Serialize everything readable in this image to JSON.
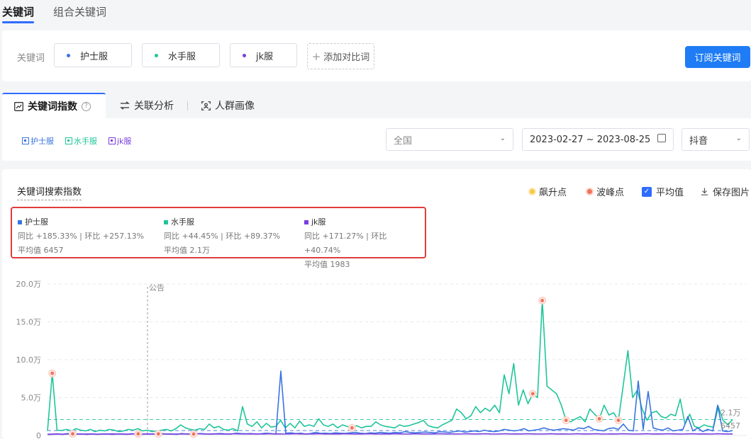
{
  "top_tabs": {
    "active": "关键词",
    "inactive": "组合关键词"
  },
  "keyword_bar": {
    "label": "关键词",
    "keywords": [
      {
        "name": "护士服",
        "color": "#3a74e0"
      },
      {
        "name": "水手服",
        "color": "#1fc59a"
      },
      {
        "name": "jk服",
        "color": "#7a3ee0"
      }
    ],
    "add_label": "添加对比词",
    "subscribe_label": "订阅关键词"
  },
  "analysis_tabs": [
    "关键词指数",
    "关联分析",
    "人群画像"
  ],
  "filters": {
    "region": "全国",
    "date_range": "2023-02-27 ~ 2023-08-25",
    "platform": "抖音"
  },
  "chart_panel": {
    "title": "关键词搜索指数",
    "options": {
      "surge": "飙升点",
      "peak": "波峰点",
      "average": "平均值",
      "average_checked": true,
      "save": "保存图片"
    },
    "summary": [
      {
        "name": "护士服",
        "yoy": "同比 +185.33%",
        "mom": "环比 +257.13%",
        "avg": "平均值 6457",
        "color": "#3a74e0"
      },
      {
        "name": "水手服",
        "yoy": "同比 +44.45%",
        "mom": "环比 +89.37%",
        "avg": "平均值 2.1万",
        "color": "#1fc59a"
      },
      {
        "name": "jk服",
        "yoy": "同比 +171.27%",
        "mom": "环比 +40.74%",
        "avg": "平均值 1983",
        "color": "#7a3ee0"
      }
    ],
    "separator": "|"
  },
  "chart_data": {
    "type": "line",
    "ylim": [
      0,
      200000
    ],
    "yticks": [
      "0",
      "5.0万",
      "10.0万",
      "15.0万",
      "20.0万"
    ],
    "annotation": "公告",
    "end_labels": [
      "2.1万",
      "6457"
    ],
    "series": [
      {
        "name": "水手服",
        "color": "#1fc59a",
        "average": 21000,
        "values": [
          6000,
          82000,
          7000,
          6500,
          8000,
          6000,
          9000,
          7000,
          6000,
          8000,
          5000,
          7000,
          6000,
          8000,
          7000,
          5000,
          6000,
          8000,
          7000,
          9000,
          6000,
          7000,
          5000,
          6000,
          7000,
          8000,
          6000,
          9000,
          14000,
          10000,
          8000,
          7000,
          9000,
          8000,
          15000,
          10000,
          12000,
          8000,
          7000,
          9000,
          6000,
          38000,
          15000,
          12000,
          18000,
          10000,
          16000,
          11000,
          12000,
          20000,
          10000,
          16000,
          10000,
          19000,
          12000,
          14000,
          12000,
          22000,
          14000,
          12000,
          15000,
          10000,
          14000,
          12000,
          10000,
          13000,
          10000,
          12000,
          12000,
          18000,
          14000,
          12000,
          11000,
          10000,
          14000,
          12000,
          13000,
          15000,
          17000,
          20000,
          13000,
          11000,
          10000,
          14000,
          17000,
          20000,
          35000,
          30000,
          22000,
          26000,
          38000,
          30000,
          36000,
          32000,
          40000,
          30000,
          80000,
          55000,
          95000,
          40000,
          60000,
          42000,
          55000,
          50000,
          178000,
          65000,
          60000,
          55000,
          40000,
          20000,
          18000,
          22000,
          25000,
          18000,
          35000,
          28000,
          22000,
          40000,
          27000,
          30000,
          20000,
          65000,
          112000,
          50000,
          60000,
          35000,
          20000,
          30000,
          32000,
          25000,
          23000,
          28000,
          26000,
          48000,
          15000,
          28000,
          12000,
          10000,
          14000,
          12000,
          11000,
          38000,
          20000,
          14000,
          21000
        ],
        "peaks": [
          1,
          64,
          102,
          104,
          109,
          116,
          120
        ]
      },
      {
        "name": "护士服",
        "color": "#3a74e0",
        "average": 6457,
        "values": [
          1500,
          1500,
          2000,
          1500,
          2500,
          1500,
          2000,
          1800,
          1500,
          2000,
          1500,
          1800,
          2000,
          1500,
          1800,
          2000,
          1500,
          2200,
          1800,
          1500,
          2000,
          1800,
          1500,
          2500,
          1800,
          2000,
          1500,
          2500,
          2000,
          1800,
          2200,
          2500,
          2000,
          1800,
          2200,
          2500,
          2000,
          1800,
          3000,
          2500,
          2200,
          2500,
          2000,
          2200,
          3000,
          2500,
          2000,
          85000,
          3000,
          3500,
          2500,
          3000,
          2000,
          2500,
          4000,
          2800,
          3000,
          2500,
          3500,
          3000,
          2800,
          3500,
          4000,
          3000,
          2500,
          3500,
          3000,
          4000,
          3500,
          3000,
          4000,
          3500,
          5000,
          4000,
          3500,
          4000,
          4500,
          4000,
          3500,
          5000,
          4500,
          4000,
          5000,
          6000,
          4500,
          5000,
          6000,
          5000,
          7000,
          5500,
          5000,
          6000,
          8000,
          7000,
          6000,
          7000,
          9000,
          6000,
          7000,
          8000,
          10000,
          8000,
          7000,
          8000,
          9000,
          8000,
          7000,
          10000,
          9000,
          12000,
          8000,
          7000,
          6000,
          9000,
          10000,
          8000,
          15000,
          7000,
          6000,
          72000,
          8000,
          58000,
          10000,
          8000,
          7000,
          10000,
          6000,
          7000,
          8000,
          25000,
          6000,
          10000,
          5000,
          8000,
          6000,
          40000,
          6000,
          5000,
          6457
        ],
        "peaks": []
      },
      {
        "name": "jk服",
        "color": "#7a3ee0",
        "average": 1983,
        "values": [
          1500,
          1800,
          2000,
          1600,
          1900,
          2100,
          1700,
          1800,
          2000,
          1900,
          1700,
          1800,
          2000,
          2100,
          1900,
          1800,
          1700,
          2000,
          2100,
          1900,
          1800,
          2000,
          2100,
          1900,
          2000,
          1800,
          1900,
          2100,
          2000,
          1900,
          2200,
          2000,
          1900,
          2100,
          2000,
          1800,
          2000,
          2200,
          2100,
          1900,
          2000,
          2100,
          2000,
          1900,
          2200,
          2000,
          2100,
          1900,
          2000,
          2200,
          2100,
          2000,
          1900,
          2100,
          2200,
          2000,
          1900,
          2100,
          2000,
          2200,
          2100,
          2000,
          1900,
          2100,
          2200,
          2000,
          1900,
          2100,
          2000,
          2200,
          2100,
          1900,
          2000,
          2200,
          2100,
          2000,
          1900,
          2100,
          2200,
          2000,
          2100,
          2000,
          1900,
          2200,
          2100,
          2000,
          2100,
          2200,
          2000,
          1900,
          2100,
          2200,
          2000,
          2100,
          2000,
          2200,
          2100,
          2000,
          1900,
          2100,
          2200,
          2000,
          2100,
          2000,
          1900,
          2200,
          2100,
          2000,
          2100,
          2200,
          2000,
          1900,
          2100,
          2000,
          2200,
          2100,
          2000,
          1900,
          2100,
          2200,
          2000,
          2100,
          2000,
          2200,
          2100,
          2000,
          1900,
          2100,
          2200,
          2000,
          2100,
          2000,
          1900,
          2200,
          2100,
          2000,
          1983
        ],
        "peaks": [
          5,
          18,
          22,
          29
        ]
      }
    ]
  }
}
